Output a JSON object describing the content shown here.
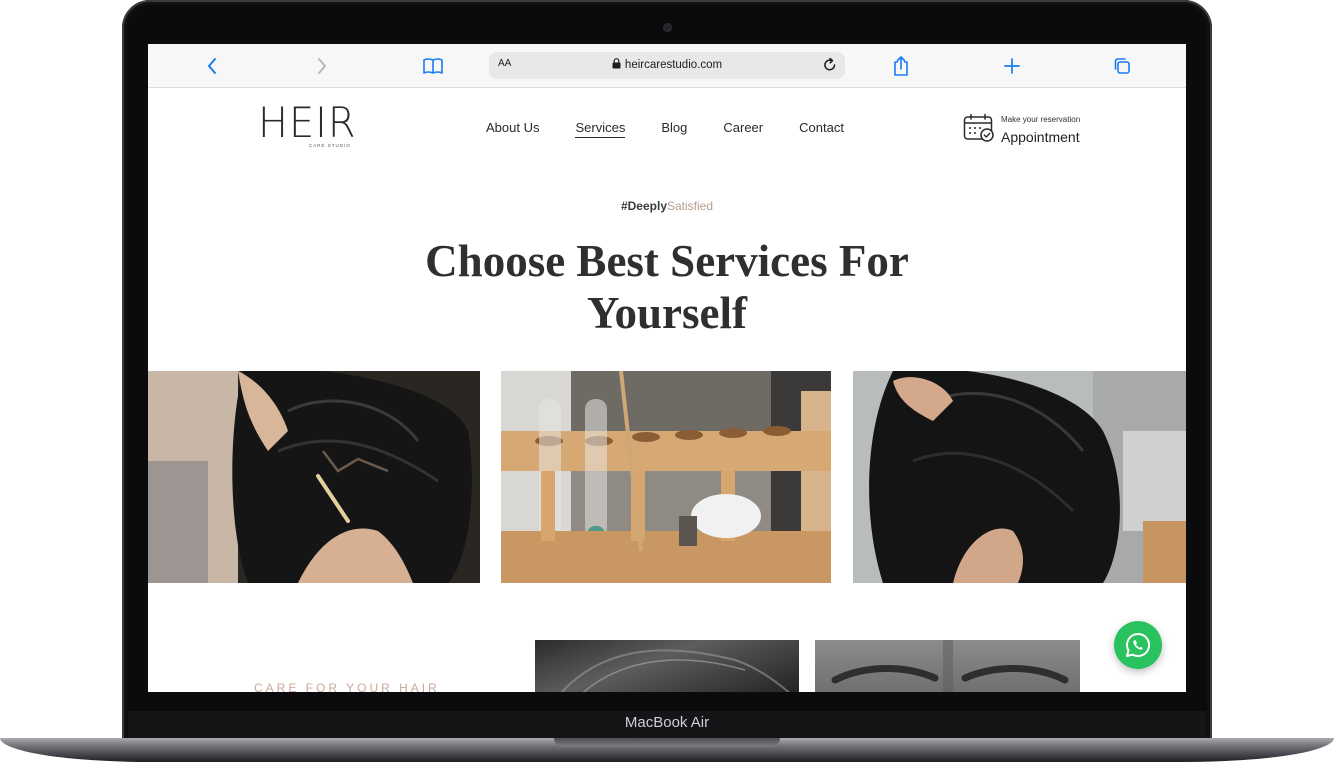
{
  "device": {
    "model": "MacBook Air"
  },
  "browser": {
    "reader_label": "AA",
    "url": "heircarestudio.com",
    "icons": [
      "back-icon",
      "forward-icon",
      "bookmarks-icon",
      "lock-icon",
      "reload-icon",
      "share-icon",
      "new-tab-icon",
      "tabs-icon"
    ]
  },
  "site": {
    "logo": {
      "main": "HEIR",
      "sub": "CARE STUDIO"
    },
    "nav": [
      {
        "label": "About Us",
        "active": false
      },
      {
        "label": "Services",
        "active": true
      },
      {
        "label": "Blog",
        "active": false
      },
      {
        "label": "Career",
        "active": false
      },
      {
        "label": "Contact",
        "active": false
      }
    ],
    "appointment": {
      "small": "Make your reservation",
      "label": "Appointment"
    },
    "hero": {
      "hashtag_part1": "#Deeply",
      "hashtag_part2": "Satisfied",
      "title": "Choose Best Services For Yourself"
    },
    "section_label": "CARE FOR YOUR HAIR",
    "colors": {
      "accent": "#b69e90",
      "whatsapp": "#29c25f",
      "text": "#2f2f2f"
    }
  }
}
